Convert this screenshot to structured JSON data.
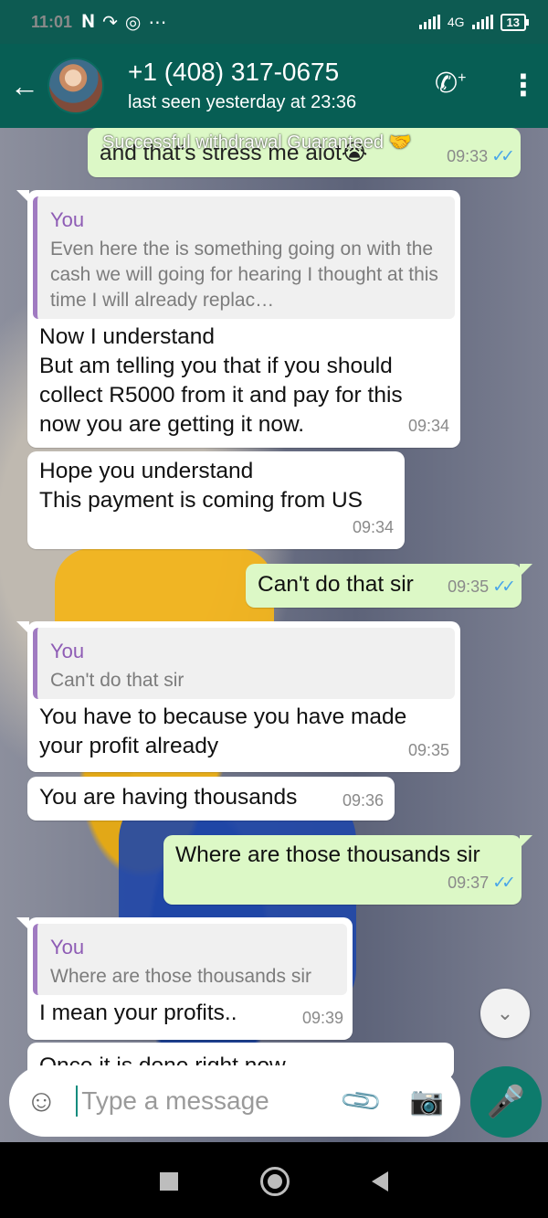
{
  "status_bar": {
    "time": "11:01",
    "network": "4G",
    "battery": "13"
  },
  "header": {
    "contact_name": "+1 (408) 317-0675",
    "last_seen": "last seen yesterday at 23:36",
    "icons": [
      "back-arrow-icon",
      "add-call-icon",
      "more-vert-icon"
    ]
  },
  "overlay": {
    "banner": "Successful withdrawal Guaranteed 🤝",
    "partial_top_message": "and that's stress me alot😭",
    "partial_top_time": "09:33"
  },
  "messages": [
    {
      "direction": "in",
      "quote_author": "You",
      "quote_text": "Even here the is something going on with the cash we will going for hearing I thought at this time I will already replac…",
      "text_lines": [
        "Now I understand",
        "But am telling you that if you should",
        "collect R5000 from it and pay for this",
        "now you are getting it now."
      ],
      "time": "09:34"
    },
    {
      "direction": "in",
      "text_lines": [
        "Hope you understand",
        "This payment is coming from US"
      ],
      "time": "09:34"
    },
    {
      "direction": "out",
      "text": "Can't do that sir",
      "time": "09:35",
      "ticks": "✓✓"
    },
    {
      "direction": "in",
      "quote_author": "You",
      "quote_text": "Can't do that sir",
      "text_lines": [
        "You have to because you have made",
        "your profit already"
      ],
      "time": "09:35"
    },
    {
      "direction": "in",
      "text": "You are having thousands",
      "time": "09:36"
    },
    {
      "direction": "out",
      "text": "Where are those thousands sir",
      "time": "09:37",
      "ticks": "✓✓"
    },
    {
      "direction": "in",
      "quote_author": "You",
      "quote_text": "Where are those thousands sir",
      "text": "I mean your profits..",
      "time": "09:39"
    },
    {
      "direction": "in",
      "text": "Once it is done right now"
    }
  ],
  "composer": {
    "placeholder": "Type a message"
  },
  "colors": {
    "header": "#075e54",
    "status_bar": "#0d5b52",
    "incoming_bubble": "#ffffff",
    "outgoing_bubble": "#dcf8c6",
    "quote_accent": "#a07ac1",
    "ticks": "#4aa6e8",
    "mic_button": "#0d7b6c"
  }
}
